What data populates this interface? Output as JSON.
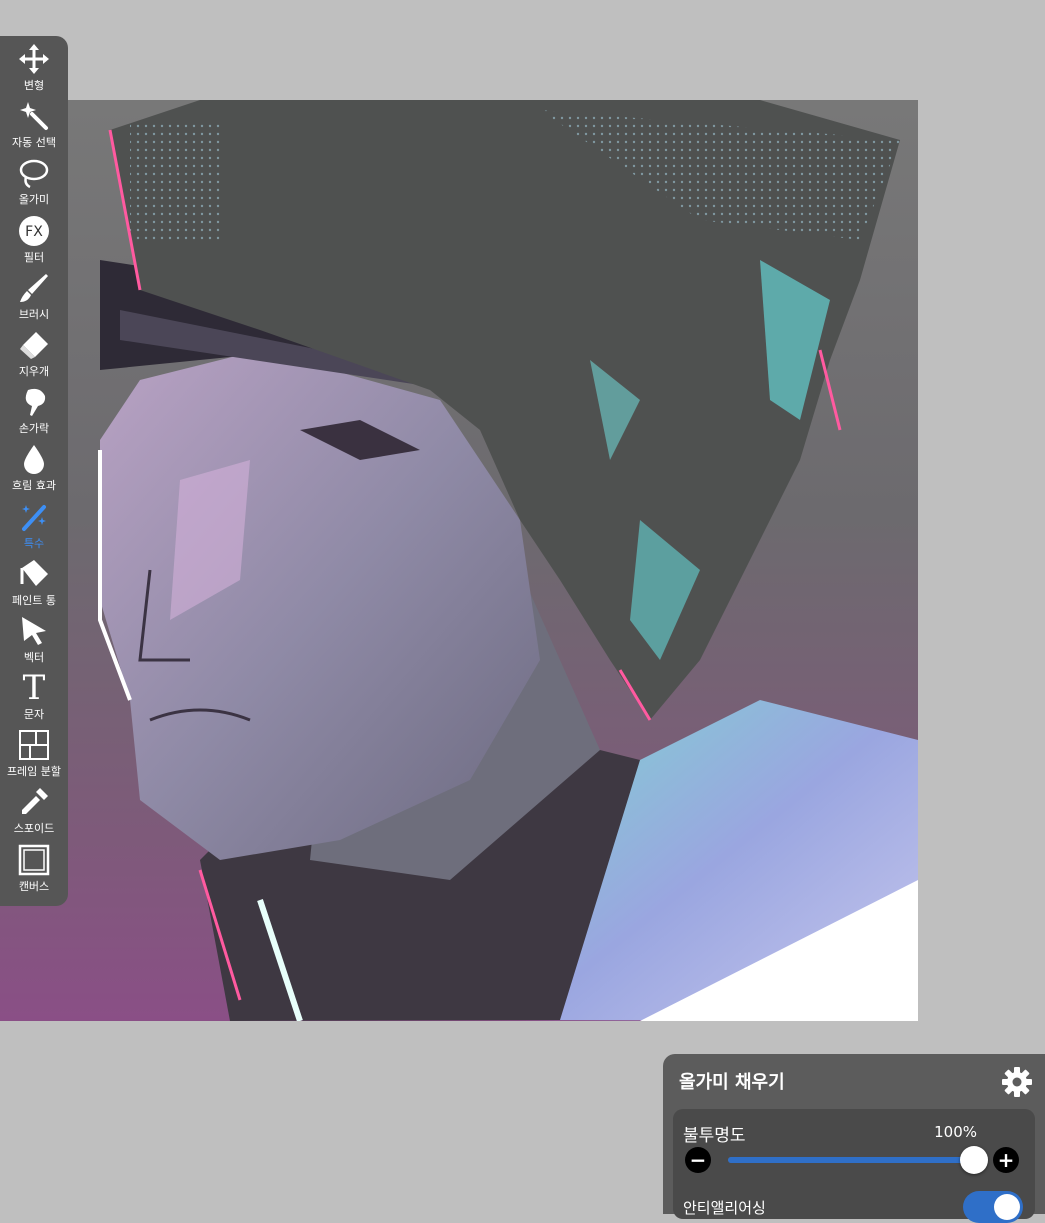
{
  "toolbar": {
    "items": [
      {
        "label": "변형",
        "icon": "move-icon"
      },
      {
        "label": "자동 선택",
        "icon": "magic-wand-icon"
      },
      {
        "label": "올가미",
        "icon": "lasso-icon"
      },
      {
        "label": "필터",
        "icon": "fx-icon"
      },
      {
        "label": "브러시",
        "icon": "brush-icon"
      },
      {
        "label": "지우개",
        "icon": "eraser-icon"
      },
      {
        "label": "손가락",
        "icon": "smudge-icon"
      },
      {
        "label": "흐림 효과",
        "icon": "blur-drop-icon"
      },
      {
        "label": "특수",
        "icon": "special-wand-icon"
      },
      {
        "label": "페인트 통",
        "icon": "paint-bucket-icon"
      },
      {
        "label": "벡터",
        "icon": "vector-arrow-icon"
      },
      {
        "label": "문자",
        "icon": "text-icon"
      },
      {
        "label": "프레임 분할",
        "icon": "frame-divider-icon"
      },
      {
        "label": "스포이드",
        "icon": "eyedropper-icon"
      },
      {
        "label": "캔버스",
        "icon": "canvas-icon"
      }
    ],
    "active_index": 8,
    "fx_text": "FX",
    "text_glyph": "T"
  },
  "panel": {
    "title": "올가미 채우기",
    "opacity_label": "불투명도",
    "opacity_value": "100%",
    "opacity_fraction": 1.0,
    "minus": "−",
    "plus": "+",
    "second_label": "안티앨리어싱",
    "second_toggle_on": true
  },
  "colors": {
    "accent": "#2f6fc8",
    "active_tool": "#3d8ff5",
    "toolbar_bg": "#565656",
    "workspace_bg": "#bfbfbf"
  }
}
